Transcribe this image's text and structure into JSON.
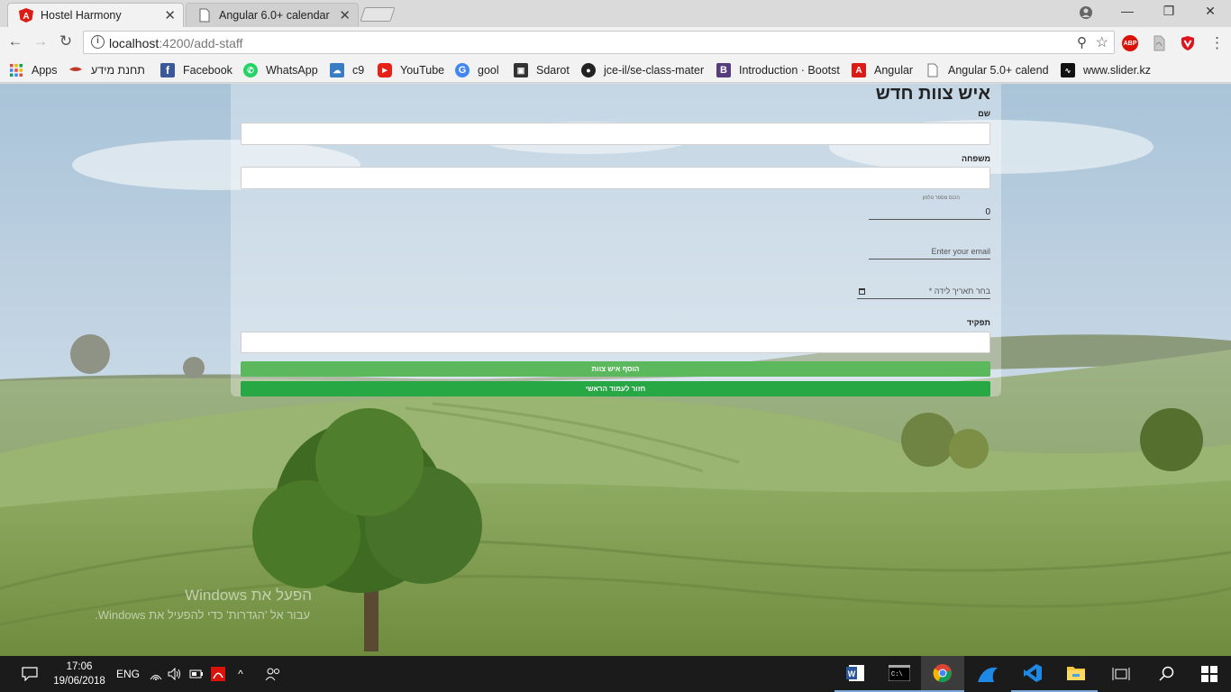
{
  "browser": {
    "tabs": [
      {
        "title": "Hostel Harmony",
        "active": true,
        "icon": "angular-icon"
      },
      {
        "title": "Angular 6.0+ calendar",
        "active": false,
        "icon": "page-icon"
      }
    ],
    "close_glyph": "✕",
    "window_controls": {
      "minimize": "—",
      "restore": "❐",
      "close": "✕"
    },
    "nav": {
      "back": "←",
      "forward": "→",
      "reload": "↻"
    },
    "url_host": "localhost",
    "url_path": ":4200/add-staff",
    "info_glyph": "i",
    "zoom_glyph": "⚲",
    "star_glyph": "☆",
    "extensions": [
      {
        "name": "adblock-plus-icon",
        "label": "ABP",
        "color": "#d9120a"
      },
      {
        "name": "pdf-extension-icon",
        "label": "",
        "color": "#b0b0b0"
      },
      {
        "name": "shield-extension-icon",
        "label": "",
        "color": "#e0141e"
      }
    ],
    "menu_glyph": "⋮"
  },
  "bookmarks": [
    {
      "label": "Apps",
      "icon": "apps-grid-icon",
      "color": "#e24b3b"
    },
    {
      "label": "תחנת מידע",
      "icon": "bookmark-red-icon",
      "color": "#c0392b"
    },
    {
      "label": "Facebook",
      "icon": "facebook-icon",
      "color": "#3b5998"
    },
    {
      "label": "WhatsApp",
      "icon": "whatsapp-icon",
      "color": "#25d366"
    },
    {
      "label": "c9",
      "icon": "cloud9-icon",
      "color": "#3a7cc3"
    },
    {
      "label": "YouTube",
      "icon": "youtube-icon",
      "color": "#e62117"
    },
    {
      "label": "gool",
      "icon": "google-icon",
      "color": "#4285f4"
    },
    {
      "label": "Sdarot",
      "icon": "tv-icon",
      "color": "#333333"
    },
    {
      "label": "jce-il/se-class-mater",
      "icon": "github-icon",
      "color": "#222222"
    },
    {
      "label": "Introduction · Bootst",
      "icon": "bootstrap-icon",
      "color": "#563d7c"
    },
    {
      "label": "Angular",
      "icon": "angular-icon",
      "color": "#dd1b16"
    },
    {
      "label": "Angular 5.0+ calend",
      "icon": "page-icon",
      "color": "#888888"
    },
    {
      "label": "www.slider.kz",
      "icon": "slider-icon",
      "color": "#111111"
    }
  ],
  "form": {
    "title": "איש צוות חדש",
    "first_name_label": "שם",
    "last_name_label": "משפחה",
    "phone_hint": "הכנס מספר טלפון",
    "phone_value": "0",
    "email_placeholder": "Enter your email",
    "birthdate_placeholder": "בחר תאריך לידה *",
    "role_label": "תפקיד",
    "submit_button": "הוסף איש צוות",
    "back_button": "חזור לעמוד הראשי"
  },
  "watermark": {
    "line1": "הפעל את Windows",
    "line2": "עבור אל 'הגדרות' כדי להפעיל את Windows."
  },
  "taskbar": {
    "time": "17:06",
    "date": "19/06/2018",
    "language": "ENG",
    "apps": [
      {
        "name": "word-icon",
        "color": "#2b579a"
      },
      {
        "name": "terminal-icon",
        "color": "#222222"
      },
      {
        "name": "chrome-icon",
        "color": "#db4437"
      },
      {
        "name": "edge-like-icon",
        "color": "#1e88e5"
      },
      {
        "name": "vscode-icon",
        "color": "#1e88e5"
      },
      {
        "name": "file-explorer-icon",
        "color": "#f5c842"
      },
      {
        "name": "task-view-icon",
        "color": "#ffffff"
      },
      {
        "name": "search-icon",
        "color": "#ffffff"
      },
      {
        "name": "start-icon",
        "color": "#ffffff"
      }
    ]
  },
  "colors": {
    "success_light": "#5cb85c",
    "success_dark": "#28a745",
    "chrome_bg": "#f2f2f2",
    "taskbar_bg": "#1b1b1b"
  }
}
